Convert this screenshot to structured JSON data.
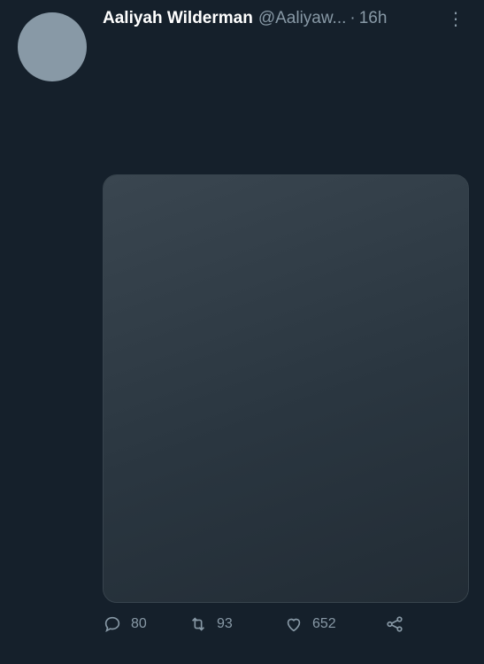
{
  "author": {
    "display_name": "Aaliyah Wilderman",
    "handle": "@Aaliyaw...",
    "separator": "·",
    "timestamp": "16h"
  },
  "menu": {
    "more_glyph": "⋮"
  },
  "tweet": {
    "text": "",
    "hashtags": []
  },
  "media": {
    "kind": "photo",
    "description": ""
  },
  "actions": {
    "replies": "80",
    "retweets": "93",
    "likes": "652"
  },
  "colors": {
    "background": "#15202b",
    "muted": "#8899a6",
    "link": "#1d9bf0",
    "border": "#38444d"
  }
}
